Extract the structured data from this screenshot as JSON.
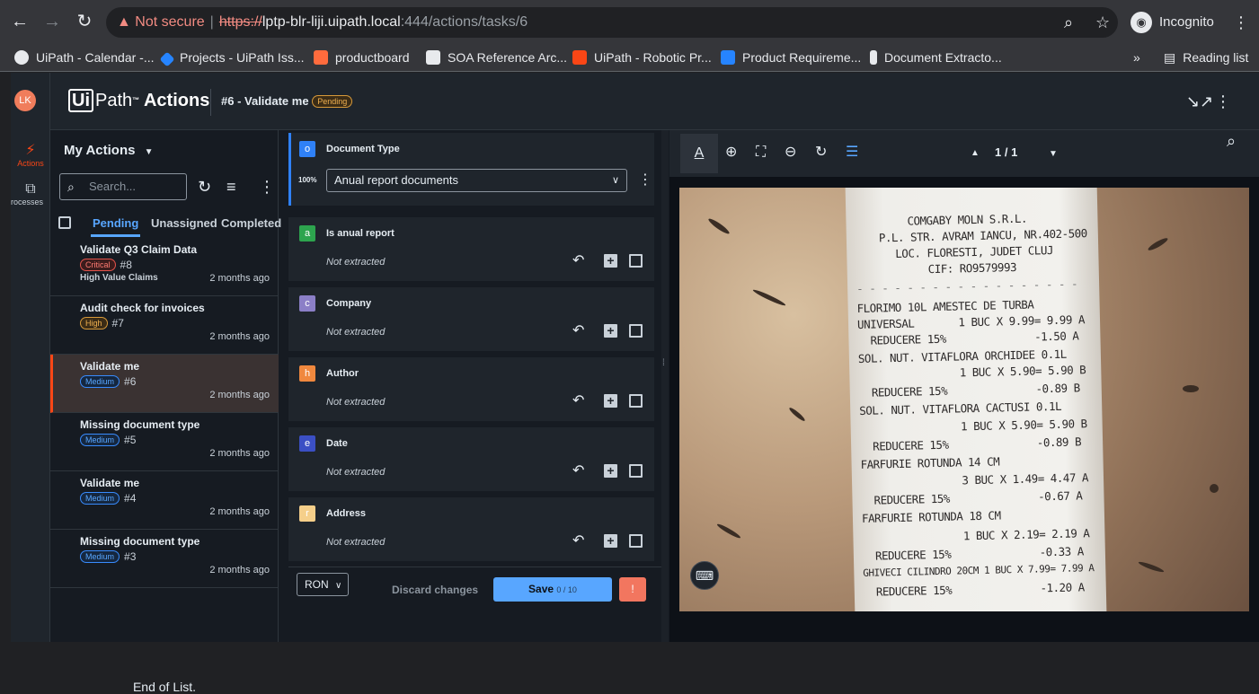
{
  "browser": {
    "security": "Not secure",
    "url_scheme": "https://",
    "url_host": "lptp-blr-liji.uipath.local",
    "url_path": ":444/actions/tasks/6",
    "incognito_label": "Incognito",
    "bookmarks": [
      {
        "label": "UiPath - Calendar -...",
        "color": "#e8eaed"
      },
      {
        "label": "Projects - UiPath Iss...",
        "color": "#2684ff"
      },
      {
        "label": "productboard",
        "color": "#ff6b3d"
      },
      {
        "label": "SOA Reference Arc...",
        "color": "#e8eaed"
      },
      {
        "label": "UiPath - Robotic Pr...",
        "color": "#fa4616"
      },
      {
        "label": "Product Requireme...",
        "color": "#2684ff"
      },
      {
        "label": "Document Extracto...",
        "color": "#e8eaed"
      }
    ],
    "reading_list": "Reading list"
  },
  "app": {
    "avatar_initials": "LK",
    "rail": [
      {
        "label": "Actions",
        "icon": "actions-icon"
      },
      {
        "label": "rocesses",
        "icon": "processes-icon"
      }
    ],
    "logo_box": "Ui",
    "logo_path": "Path",
    "logo_tm": "™",
    "logo_product": "Actions",
    "task_title": "#6 - Validate me",
    "task_status": "Pending"
  },
  "sidebar": {
    "title": "My Actions",
    "search_placeholder": "Search...",
    "tabs": [
      "Pending",
      "Unassigned",
      "Completed"
    ],
    "tasks": [
      {
        "title": "Validate Q3 Claim Data",
        "priority": "Critical",
        "priority_class": "critical",
        "number": "#8",
        "subtitle": "High Value Claims",
        "time": "2 months ago"
      },
      {
        "title": "Audit check for invoices",
        "priority": "High",
        "priority_class": "high",
        "number": "#7",
        "subtitle": "",
        "time": "2 months ago"
      },
      {
        "title": "Validate me",
        "priority": "Medium",
        "priority_class": "medium",
        "number": "#6",
        "subtitle": "",
        "time": "2 months ago",
        "selected": true
      },
      {
        "title": "Missing document type",
        "priority": "Medium",
        "priority_class": "medium",
        "number": "#5",
        "subtitle": "",
        "time": "2 months ago"
      },
      {
        "title": "Validate me",
        "priority": "Medium",
        "priority_class": "medium",
        "number": "#4",
        "subtitle": "",
        "time": "2 months ago"
      },
      {
        "title": "Missing document type",
        "priority": "Medium",
        "priority_class": "medium",
        "number": "#3",
        "subtitle": "",
        "time": "2 months ago"
      }
    ],
    "end_of_list": "End of List."
  },
  "fields": {
    "document_type": {
      "tag": "o",
      "tag_color": "#2f81f7",
      "label": "Document Type",
      "confidence": "100%",
      "value": "Anual report documents"
    },
    "items": [
      {
        "tag": "a",
        "tag_color": "#2da44e",
        "label": "Is anual report",
        "value": "Not extracted"
      },
      {
        "tag": "c",
        "tag_color": "#8b7fc7",
        "label": "Company",
        "value": "Not extracted"
      },
      {
        "tag": "h",
        "tag_color": "#f0883e",
        "label": "Author",
        "value": "Not extracted"
      },
      {
        "tag": "e",
        "tag_color": "#3b4fc4",
        "label": "Date",
        "value": "Not extracted"
      },
      {
        "tag": "r",
        "tag_color": "#f5cf8a",
        "label": "Address",
        "value": "Not extracted"
      }
    ],
    "currency": "RON",
    "discard_label": "Discard changes",
    "save_label": "Save",
    "save_count": "0 / 10",
    "error_label": "!"
  },
  "viewer": {
    "page_current": "1",
    "page_sep": "/",
    "page_total": "1",
    "receipt_lines": [
      "COMGABY MOLN S.R.L.",
      "P.L. STR. AVRAM IANCU, NR.402-500",
      "LOC. FLORESTI, JUDET CLUJ",
      "CIF: RO9579993",
      "- - - - - - - - - - - - - - - - - -",
      "FLORIMO 10L AMESTEC DE TURBA",
      "UNIVERSAL       1 BUC X 9.99= 9.99 A",
      "  REDUCERE 15%              -1.50 A",
      "SOL. NUT. VITAFLORA ORCHIDEE 0.1L",
      "                1 BUC X 5.90= 5.90 B",
      "  REDUCERE 15%              -0.89 B",
      "SOL. NUT. VITAFLORA CACTUSI 0.1L",
      "                1 BUC X 5.90= 5.90 B",
      "  REDUCERE 15%              -0.89 B",
      "FARFURIE ROTUNDA 14 CM",
      "                3 BUC X 1.49= 4.47 A",
      "  REDUCERE 15%              -0.67 A",
      "FARFURIE ROTUNDA 18 CM",
      "                1 BUC X 2.19= 2.19 A",
      "  REDUCERE 15%              -0.33 A",
      "GHIVECI CILINDRO 20CM 1 BUC X 7.99= 7.99 A",
      "  REDUCERE 15%              -1.20 A"
    ]
  }
}
